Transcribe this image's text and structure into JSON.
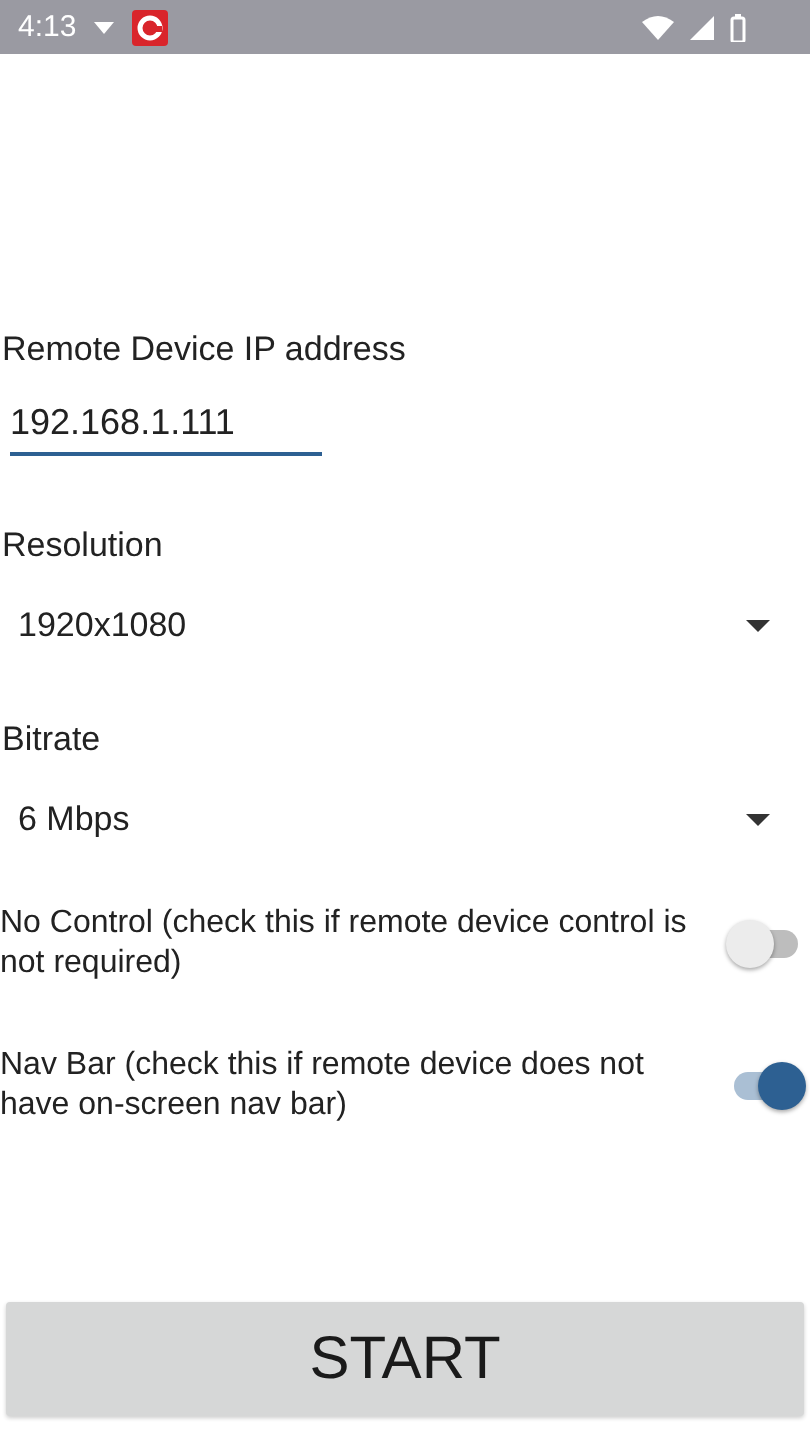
{
  "status_bar": {
    "time": "4:13"
  },
  "ip": {
    "label": "Remote Device IP address",
    "value": "192.168.1.111"
  },
  "dropdowns": [
    {
      "label": "Resolution",
      "value": "1920x1080"
    },
    {
      "label": "Bitrate",
      "value": "6 Mbps"
    }
  ],
  "switches": [
    {
      "label": "No Control (check this if remote device control is not required)",
      "on": false
    },
    {
      "label": "Nav Bar (check this if remote device does not have on-screen nav bar)",
      "on": true
    }
  ],
  "button": "START"
}
